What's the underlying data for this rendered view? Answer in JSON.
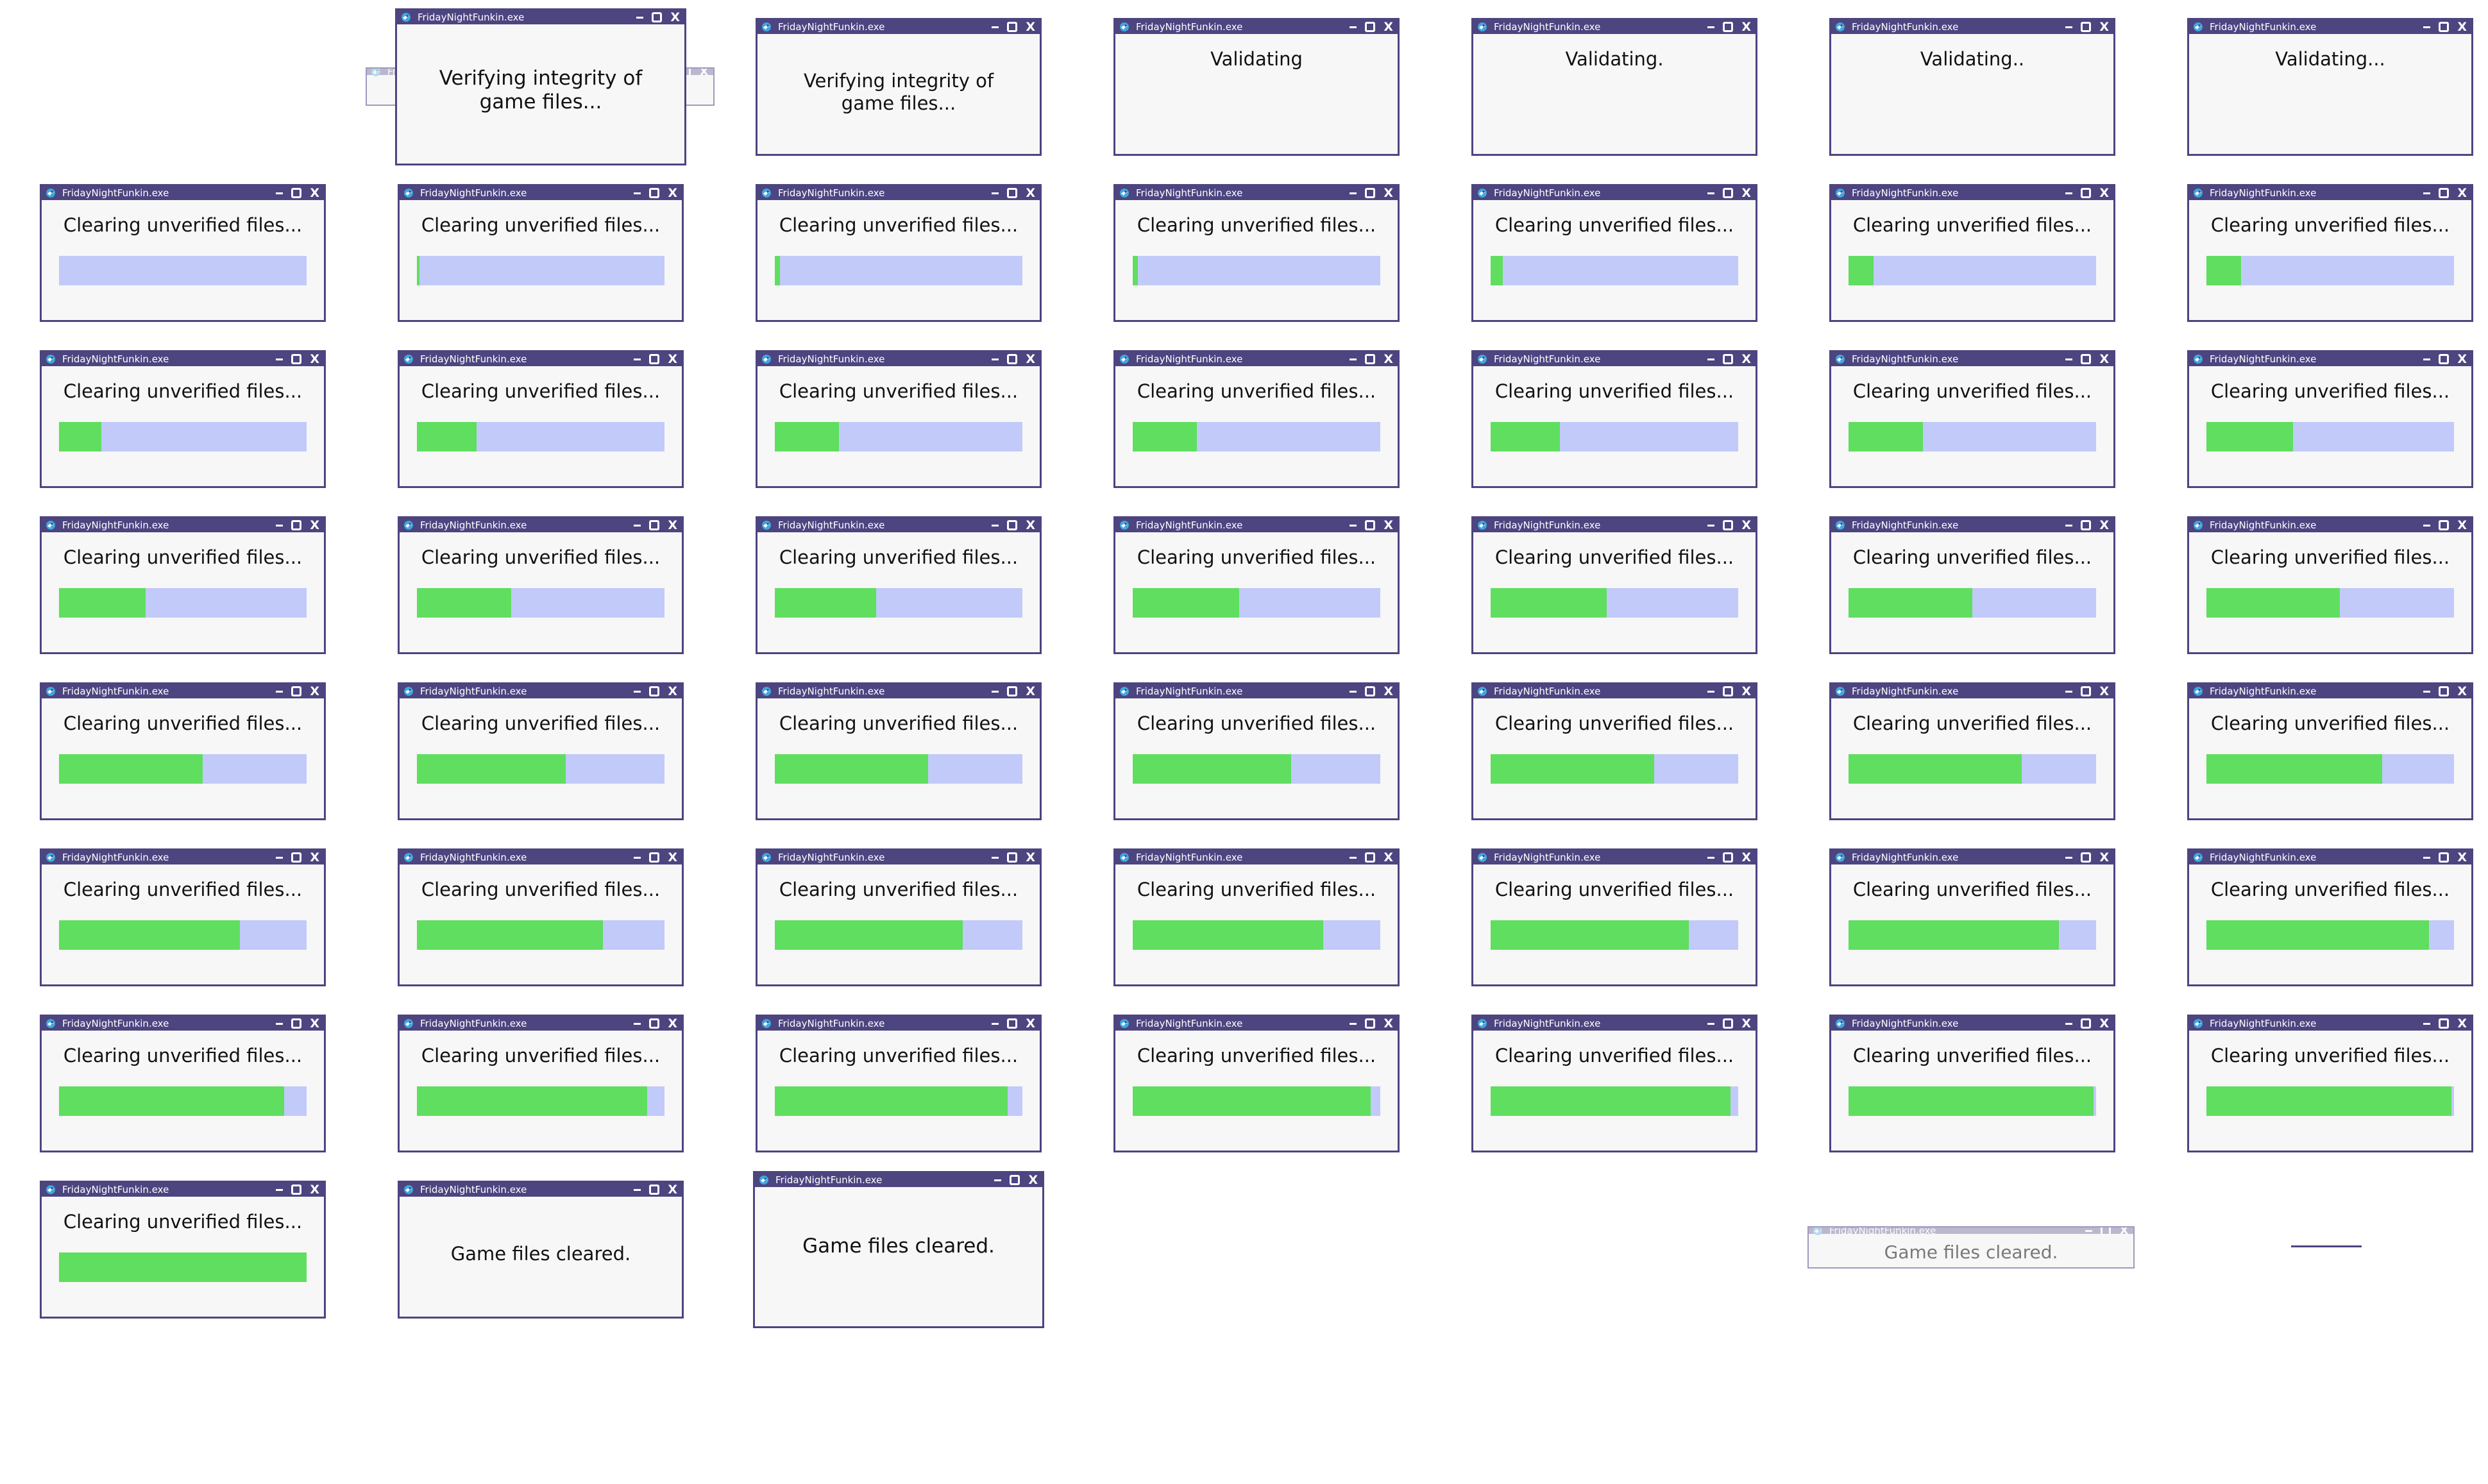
{
  "app": {
    "window_title": "FridayNightFunkin.exe",
    "icons": {
      "app": "app-logo-icon",
      "minimize": "minimize-icon",
      "maximize": "maximize-icon",
      "close": "close-icon"
    },
    "close_glyph": "X"
  },
  "colors": {
    "titlebar": "#4c4580",
    "window_bg": "#f7f7f7",
    "track": "#c1caf9",
    "fill": "#60de5f"
  },
  "frames": [
    {
      "state": "open-anim",
      "message": "Verifying integrity of game files...",
      "progress": null
    },
    {
      "state": "large",
      "message": "Verifying integrity of game files...",
      "progress": null
    },
    {
      "state": "normal",
      "message": "Verifying integrity of game files...",
      "progress": null
    },
    {
      "state": "normal",
      "message": "Validating",
      "progress": null
    },
    {
      "state": "normal",
      "message": "Validating.",
      "progress": null
    },
    {
      "state": "normal",
      "message": "Validating..",
      "progress": null
    },
    {
      "state": "normal",
      "message": "Validating...",
      "progress": null
    },
    {
      "state": "normal",
      "message": "Clearing unverified files...",
      "progress": 0
    },
    {
      "state": "normal",
      "message": "Clearing unverified files...",
      "progress": 0.01
    },
    {
      "state": "normal",
      "message": "Clearing unverified files...",
      "progress": 0.02
    },
    {
      "state": "normal",
      "message": "Clearing unverified files...",
      "progress": 0.02
    },
    {
      "state": "normal",
      "message": "Clearing unverified files...",
      "progress": 0.05
    },
    {
      "state": "normal",
      "message": "Clearing unverified files...",
      "progress": 0.1
    },
    {
      "state": "normal",
      "message": "Clearing unverified files...",
      "progress": 0.14
    },
    {
      "state": "normal",
      "message": "Clearing unverified files...",
      "progress": 0.17
    },
    {
      "state": "normal",
      "message": "Clearing unverified files...",
      "progress": 0.24
    },
    {
      "state": "normal",
      "message": "Clearing unverified files...",
      "progress": 0.26
    },
    {
      "state": "normal",
      "message": "Clearing unverified files...",
      "progress": 0.26
    },
    {
      "state": "normal",
      "message": "Clearing unverified files...",
      "progress": 0.28
    },
    {
      "state": "normal",
      "message": "Clearing unverified files...",
      "progress": 0.3
    },
    {
      "state": "normal",
      "message": "Clearing unverified files...",
      "progress": 0.35
    },
    {
      "state": "normal",
      "message": "Clearing unverified files...",
      "progress": 0.35
    },
    {
      "state": "normal",
      "message": "Clearing unverified files...",
      "progress": 0.38
    },
    {
      "state": "normal",
      "message": "Clearing unverified files...",
      "progress": 0.41
    },
    {
      "state": "normal",
      "message": "Clearing unverified files...",
      "progress": 0.43
    },
    {
      "state": "normal",
      "message": "Clearing unverified files...",
      "progress": 0.47
    },
    {
      "state": "normal",
      "message": "Clearing unverified files...",
      "progress": 0.5
    },
    {
      "state": "normal",
      "message": "Clearing unverified files...",
      "progress": 0.54
    },
    {
      "state": "normal",
      "message": "Clearing unverified files...",
      "progress": 0.58
    },
    {
      "state": "normal",
      "message": "Clearing unverified files...",
      "progress": 0.6
    },
    {
      "state": "normal",
      "message": "Clearing unverified files...",
      "progress": 0.62
    },
    {
      "state": "normal",
      "message": "Clearing unverified files...",
      "progress": 0.64
    },
    {
      "state": "normal",
      "message": "Clearing unverified files...",
      "progress": 0.66
    },
    {
      "state": "normal",
      "message": "Clearing unverified files...",
      "progress": 0.7
    },
    {
      "state": "normal",
      "message": "Clearing unverified files...",
      "progress": 0.71
    },
    {
      "state": "normal",
      "message": "Clearing unverified files...",
      "progress": 0.73
    },
    {
      "state": "normal",
      "message": "Clearing unverified files...",
      "progress": 0.75
    },
    {
      "state": "normal",
      "message": "Clearing unverified files...",
      "progress": 0.76
    },
    {
      "state": "normal",
      "message": "Clearing unverified files...",
      "progress": 0.77
    },
    {
      "state": "normal",
      "message": "Clearing unverified files...",
      "progress": 0.8
    },
    {
      "state": "normal",
      "message": "Clearing unverified files...",
      "progress": 0.85
    },
    {
      "state": "normal",
      "message": "Clearing unverified files...",
      "progress": 0.9
    },
    {
      "state": "normal",
      "message": "Clearing unverified files...",
      "progress": 0.91
    },
    {
      "state": "normal",
      "message": "Clearing unverified files...",
      "progress": 0.93
    },
    {
      "state": "normal",
      "message": "Clearing unverified files...",
      "progress": 0.94
    },
    {
      "state": "normal",
      "message": "Clearing unverified files...",
      "progress": 0.96
    },
    {
      "state": "normal",
      "message": "Clearing unverified files...",
      "progress": 0.97
    },
    {
      "state": "normal",
      "message": "Clearing unverified files...",
      "progress": 0.99
    },
    {
      "state": "normal",
      "message": "Clearing unverified files...",
      "progress": 0.99
    },
    {
      "state": "normal",
      "message": "Clearing unverified files...",
      "progress": 1.0
    },
    {
      "state": "normal",
      "message": "Game files cleared.",
      "progress": null
    },
    {
      "state": "large",
      "message": "Game files cleared.",
      "progress": null
    },
    {
      "state": "close-anim",
      "message": "Game files cleared.",
      "progress": null
    },
    {
      "state": "collapsed",
      "message": "",
      "progress": null
    }
  ]
}
